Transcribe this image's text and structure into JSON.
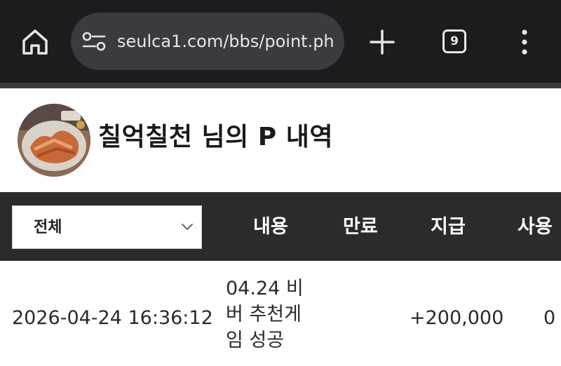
{
  "browser": {
    "url": "seulca1.com/bbs/point.ph",
    "tab_count": "9"
  },
  "profile": {
    "title": "칠억칠천 님의 P 내역"
  },
  "table": {
    "filter_selected": "전체",
    "columns": {
      "content": "내용",
      "expiry": "만료",
      "given": "지급",
      "used": "사용"
    },
    "rows": [
      {
        "date": "2026-04-24 16:36:12",
        "content_lines": [
          "04.24 비",
          "버 추천게",
          "임 성공"
        ],
        "given": "+200,000",
        "used": "0"
      }
    ]
  }
}
